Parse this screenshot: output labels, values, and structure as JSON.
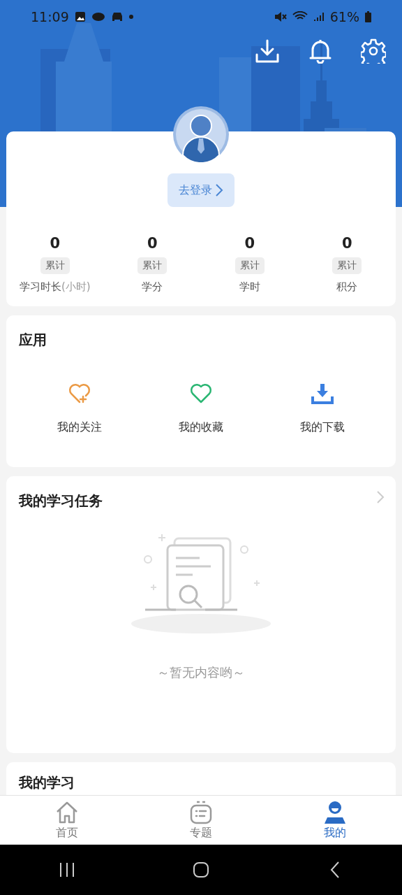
{
  "status_bar": {
    "time": "11:09",
    "battery": "61%"
  },
  "profile": {
    "login_button": "去登录",
    "stats": [
      {
        "value": "0",
        "tag": "累计",
        "label": "学习时长",
        "unit": "(小时)"
      },
      {
        "value": "0",
        "tag": "累计",
        "label": "学分"
      },
      {
        "value": "0",
        "tag": "累计",
        "label": "学时"
      },
      {
        "value": "0",
        "tag": "累计",
        "label": "积分"
      }
    ]
  },
  "apps": {
    "title": "应用",
    "items": [
      {
        "kind": "follow",
        "label": "我的关注",
        "color": "#eb9a45"
      },
      {
        "kind": "favorite",
        "label": "我的收藏",
        "color": "#2bb673"
      },
      {
        "kind": "download",
        "label": "我的下载",
        "color": "#3b7fe0"
      }
    ]
  },
  "tasks": {
    "title": "我的学习任务",
    "empty_text": "～暂无内容哟～"
  },
  "study": {
    "title": "我的学习"
  },
  "tab_bar": [
    {
      "kind": "home",
      "label": "首页",
      "selected": false
    },
    {
      "kind": "topics",
      "label": "专题",
      "selected": false
    },
    {
      "kind": "me",
      "label": "我的",
      "selected": true
    }
  ]
}
